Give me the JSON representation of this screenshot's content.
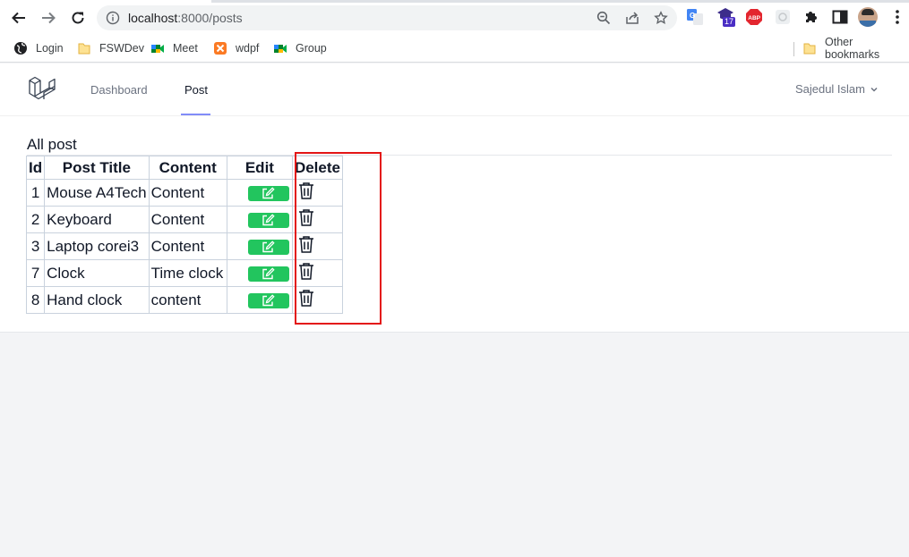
{
  "browser": {
    "url_host": "localhost",
    "url_path": ":8000/posts"
  },
  "bookmarks": {
    "items": [
      {
        "label": "Login",
        "icon": "globe-icon"
      },
      {
        "label": "FSWDev",
        "icon": "folder-icon"
      },
      {
        "label": "Meet",
        "icon": "google-meet-icon"
      },
      {
        "label": "wdpf",
        "icon": "xampp-icon"
      },
      {
        "label": "Group",
        "icon": "google-meet-icon"
      }
    ],
    "other": "Other bookmarks"
  },
  "extensions": {
    "badge": "17"
  },
  "nav": {
    "links": [
      {
        "label": "Dashboard",
        "active": false
      },
      {
        "label": "Post",
        "active": true
      }
    ],
    "user": "Sajedul Islam"
  },
  "page": {
    "heading": "All post"
  },
  "table": {
    "headers": [
      "Id",
      "Post Title",
      "Content",
      "Edit",
      "Delete"
    ],
    "rows": [
      {
        "id": "1",
        "title": "Mouse A4Tech",
        "content": "Content"
      },
      {
        "id": "2",
        "title": "Keyboard",
        "content": "Content"
      },
      {
        "id": "3",
        "title": "Laptop corei3",
        "content": "Content"
      },
      {
        "id": "7",
        "title": "Clock",
        "content": "Time clock"
      },
      {
        "id": "8",
        "title": "Hand clock",
        "content": "content"
      }
    ]
  },
  "colors": {
    "edit_button": "#22c55e",
    "highlight_box": "#e31515",
    "nav_underline": "#818cf8"
  }
}
